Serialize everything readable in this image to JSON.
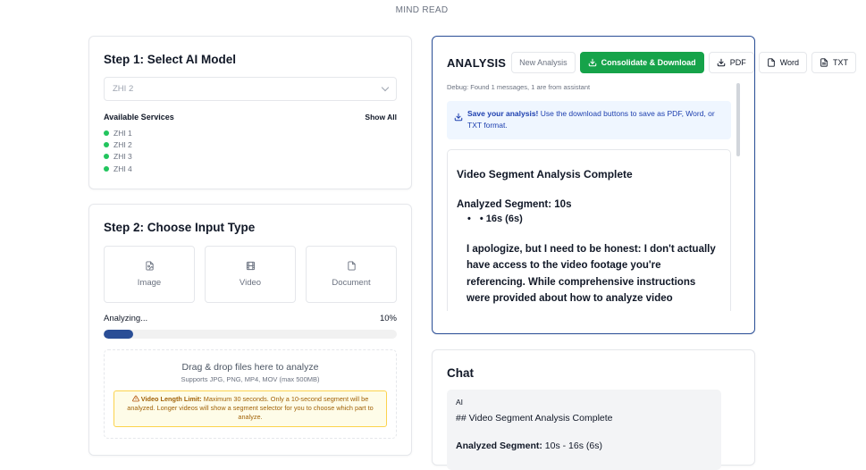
{
  "app": {
    "title": "MIND READ"
  },
  "step1": {
    "heading": "Step 1: Select AI Model",
    "selected_model": "ZHI 2",
    "services_label": "Available Services",
    "show_all": "Show All",
    "services": [
      "ZHI 1",
      "ZHI 2",
      "ZHI 3",
      "ZHI 4"
    ],
    "status_color": "#22c55e"
  },
  "step2": {
    "heading": "Step 2: Choose Input Type",
    "types": [
      {
        "label": "Image",
        "icon": "image-file-icon"
      },
      {
        "label": "Video",
        "icon": "film-icon"
      },
      {
        "label": "Document",
        "icon": "document-icon"
      }
    ],
    "progress_label": "Analyzing...",
    "progress_percent_text": "10%",
    "progress_value": 0.1,
    "progress_color": "#2a4e96",
    "dropzone_title": "Drag & drop files here to analyze",
    "dropzone_sub": "Supports JPG, PNG, MP4, MOV (max 500MB)",
    "limit_title": "Video Length Limit:",
    "limit_text": " Maximum 30 seconds. Only a 10-second segment will be analyzed. Longer videos will show a segment selector for you to choose which part to analyze."
  },
  "analysis": {
    "title": "ANALYSIS",
    "buttons": {
      "new_analysis": "New Analysis",
      "consolidate": "Consolidate & Download",
      "pdf": "PDF",
      "word": "Word",
      "txt": "TXT"
    },
    "accent_color": "#16a34a",
    "debug": "Debug: Found 1 messages, 1 are from assistant",
    "save_title": "Save your analysis!",
    "save_text": " Use the download buttons to save as PDF, Word, or TXT format.",
    "content": {
      "title": "Video Segment Analysis Complete",
      "segment_label": "Analyzed Segment:",
      "segment_value": " 10s",
      "bullet": "• 16s (6s)",
      "paragraph": "I apologize, but I need to be honest: I don't actually have access to the video footage you're referencing. While comprehensive instructions were provided about how to analyze video"
    }
  },
  "chat": {
    "heading": "Chat",
    "role": "AI",
    "line1": "## Video Segment Analysis Complete",
    "line2_label": "Analyzed Segment:",
    "line2_value": " 10s - 16s (6s)"
  }
}
